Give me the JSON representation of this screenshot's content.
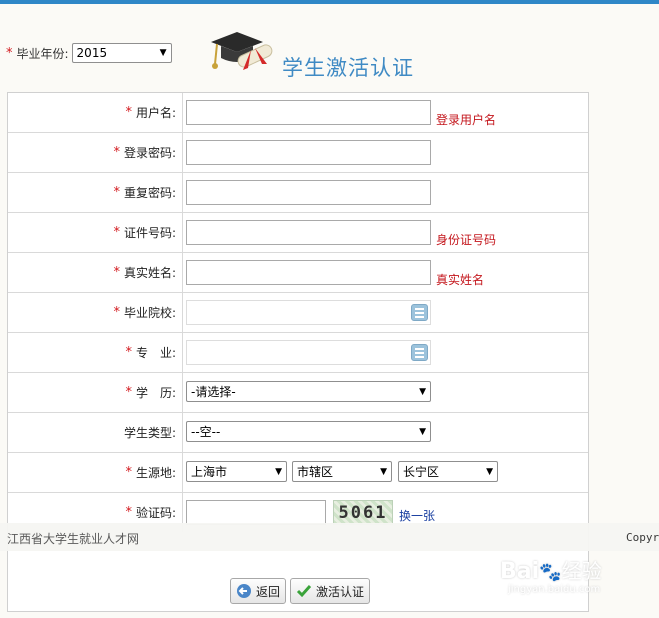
{
  "graduation_year": {
    "label": "毕业年份:",
    "value": "2015"
  },
  "page_title": "学生激活认证",
  "form": {
    "username": {
      "label": "用户名:",
      "hint": "登录用户名",
      "value": ""
    },
    "password": {
      "label": "登录密码:",
      "value": ""
    },
    "repeat_password": {
      "label": "重复密码:",
      "value": ""
    },
    "id_number": {
      "label": "证件号码:",
      "hint": "身份证号码",
      "value": ""
    },
    "real_name": {
      "label": "真实姓名:",
      "hint": "真实姓名",
      "value": ""
    },
    "school": {
      "label": "毕业院校:",
      "value": ""
    },
    "major": {
      "label": "专　业:",
      "value": ""
    },
    "education": {
      "label": "学　历:",
      "value": "-请选择-"
    },
    "student_type": {
      "label": "学生类型:",
      "value": "--空--"
    },
    "origin": {
      "label": "生源地:",
      "province": "上海市",
      "city": "市辖区",
      "district": "长宁区"
    },
    "captcha": {
      "label": "验证码:",
      "value": "",
      "image_text": "5061",
      "refresh_label": "换一张"
    }
  },
  "footer": {
    "site_name": "江西省大学生就业人才网",
    "copyright": "Copyr"
  },
  "buttons": {
    "back_label": "返回",
    "activate_label": "激活认证"
  },
  "watermark": {
    "brand": "Bai",
    "brand2": "经验",
    "url": "jingyan.baidu.com"
  },
  "colors": {
    "accent": "#2f87c7",
    "required": "#d2171c",
    "title": "#3f8ac4"
  }
}
